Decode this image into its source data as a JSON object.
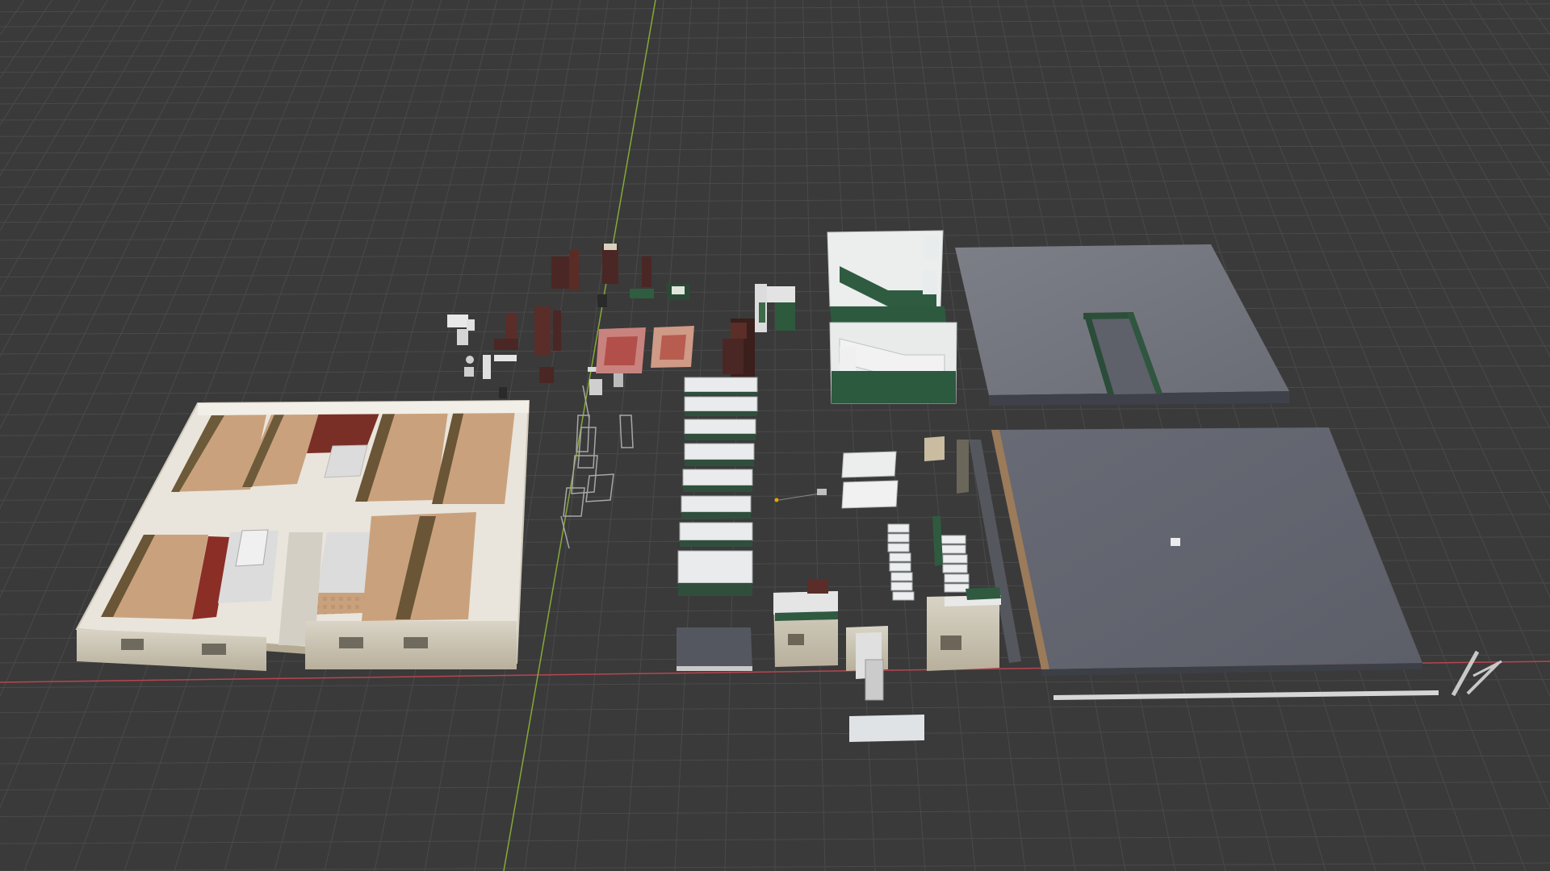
{
  "viewport": {
    "background_color": "#3a3a3a",
    "grid_color": "#4a4a4a",
    "x_axis_color": "#c9434f",
    "y_axis_color": "#7fae2f"
  },
  "scene": {
    "objects": [
      "apartment-floor-plan",
      "furniture-set",
      "carpets",
      "glass-railings",
      "shelving-stack",
      "stair-wall-modules",
      "roof-slab-with-opening",
      "floor-slab",
      "wall-modules",
      "stair-flights",
      "pipe-segment"
    ]
  }
}
